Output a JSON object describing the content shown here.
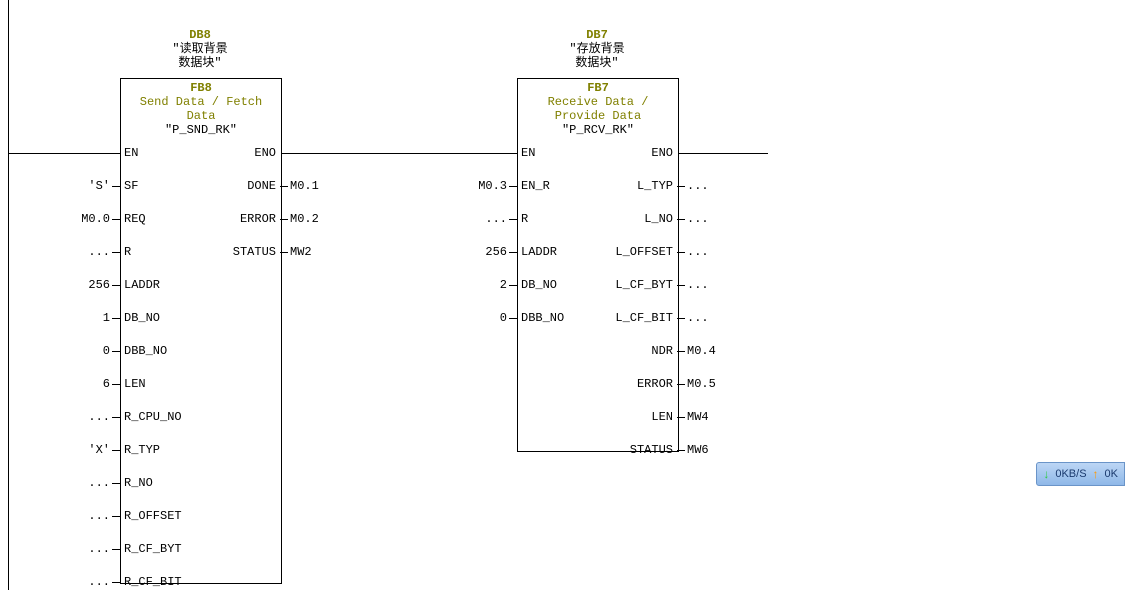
{
  "block1": {
    "db": "DB8",
    "db_text1": "″读取背景",
    "db_text2": "数据块″",
    "fb": "FB8",
    "title1": "Send Data / Fetch",
    "title2": "Data",
    "inst": "″P_SND_RK″",
    "inputs": [
      {
        "name": "EN",
        "val": ""
      },
      {
        "name": "SF",
        "val": "'S'"
      },
      {
        "name": "REQ",
        "val": "M0.0"
      },
      {
        "name": "R",
        "val": "..."
      },
      {
        "name": "LADDR",
        "val": "256"
      },
      {
        "name": "DB_NO",
        "val": "1"
      },
      {
        "name": "DBB_NO",
        "val": "0"
      },
      {
        "name": "LEN",
        "val": "6"
      },
      {
        "name": "R_CPU_NO",
        "val": "..."
      },
      {
        "name": "R_TYP",
        "val": "'X'"
      },
      {
        "name": "R_NO",
        "val": "..."
      },
      {
        "name": "R_OFFSET",
        "val": "..."
      },
      {
        "name": "R_CF_BYT",
        "val": "..."
      },
      {
        "name": "R_CF_BIT",
        "val": "..."
      }
    ],
    "outputs": [
      {
        "name": "ENO",
        "val": ""
      },
      {
        "name": "DONE",
        "val": "M0.1"
      },
      {
        "name": "ERROR",
        "val": "M0.2"
      },
      {
        "name": "STATUS",
        "val": "MW2"
      }
    ]
  },
  "block2": {
    "db": "DB7",
    "db_text1": "″存放背景",
    "db_text2": "数据块″",
    "fb": "FB7",
    "title1": "Receive Data /",
    "title2": "Provide Data",
    "inst": "″P_RCV_RK″",
    "inputs": [
      {
        "name": "EN",
        "val": ""
      },
      {
        "name": "EN_R",
        "val": "M0.3"
      },
      {
        "name": "R",
        "val": "..."
      },
      {
        "name": "LADDR",
        "val": "256"
      },
      {
        "name": "DB_NO",
        "val": "2"
      },
      {
        "name": "DBB_NO",
        "val": "0"
      }
    ],
    "outputs": [
      {
        "name": "ENO",
        "val": ""
      },
      {
        "name": "L_TYP",
        "val": "..."
      },
      {
        "name": "L_NO",
        "val": "..."
      },
      {
        "name": "L_OFFSET",
        "val": "..."
      },
      {
        "name": "L_CF_BYT",
        "val": "..."
      },
      {
        "name": "L_CF_BIT",
        "val": "..."
      },
      {
        "name": "NDR",
        "val": "M0.4"
      },
      {
        "name": "ERROR",
        "val": "M0.5"
      },
      {
        "name": "LEN",
        "val": "MW4"
      },
      {
        "name": "STATUS",
        "val": "MW6"
      }
    ]
  },
  "netmon": {
    "down": "0KB/S",
    "up": "0K"
  }
}
